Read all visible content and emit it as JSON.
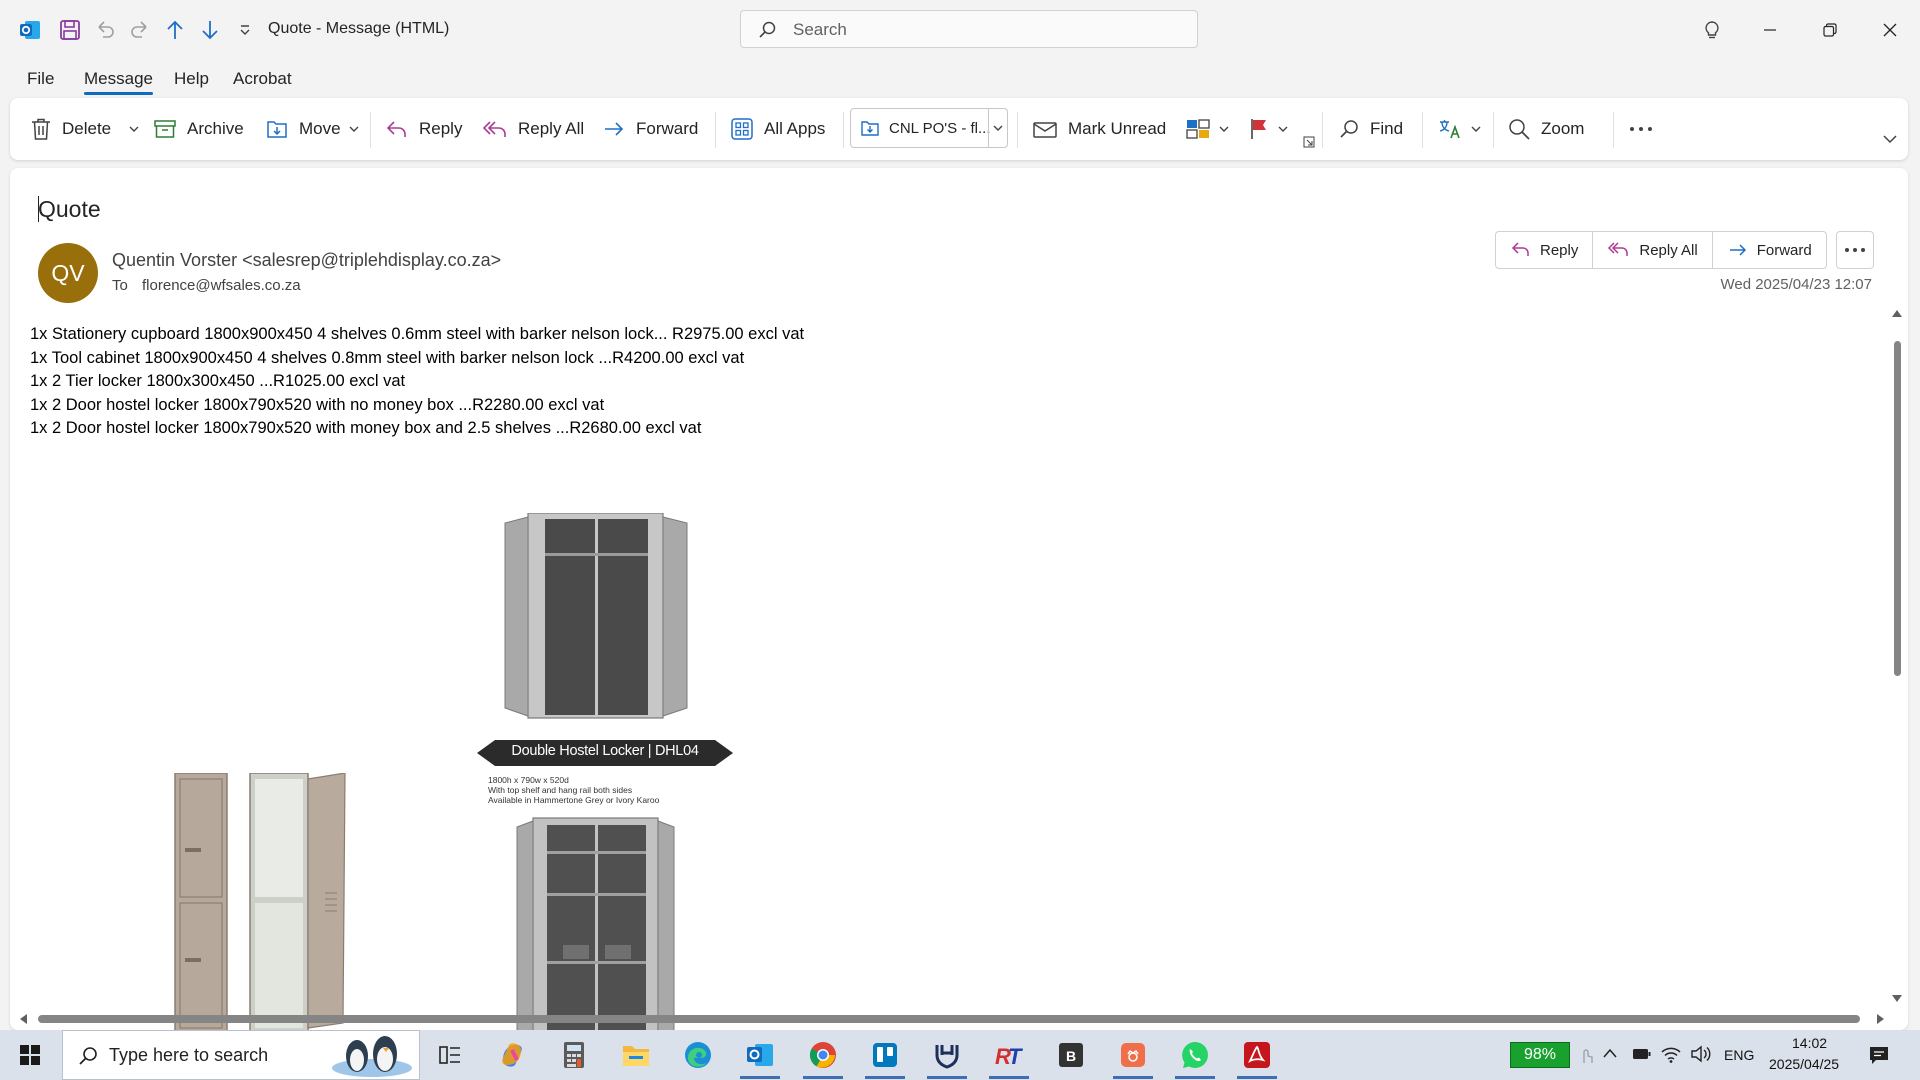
{
  "window": {
    "title": "Quote  -  Message (HTML)",
    "search_placeholder": "Search"
  },
  "menu": {
    "file": "File",
    "message": "Message",
    "help": "Help",
    "acrobat": "Acrobat"
  },
  "ribbon": {
    "delete": "Delete",
    "archive": "Archive",
    "move": "Move",
    "reply": "Reply",
    "reply_all": "Reply All",
    "forward": "Forward",
    "all_apps": "All Apps",
    "quick_step": "CNL PO'S - fl...",
    "mark_unread": "Mark Unread",
    "find": "Find",
    "zoom": "Zoom"
  },
  "email": {
    "subject": "Quote",
    "avatar_initials": "QV",
    "avatar_color": "#986f0b",
    "sender": "Quentin Vorster <salesrep@triplehdisplay.co.za>",
    "to_label": "To",
    "to": "florence@wfsales.co.za",
    "date": "Wed 2025/04/23 12:07",
    "actions": {
      "reply": "Reply",
      "reply_all": "Reply All",
      "forward": "Forward"
    },
    "body": [
      "1x Stationery cupboard 1800x900x450 4 shelves  0.6mm steel with barker nelson lock... R2975.00 excl vat",
      "1x Tool cabinet 1800x900x450 4 shelves  0.8mm steel with barker nelson lock ...R4200.00 excl vat",
      "1x 2 Tier locker 1800x300x450 ...R1025.00 excl vat",
      "1x 2 Door hostel locker 1800x790x520 with no money box ...R2280.00 excl vat",
      "1x 2 Door hostel locker 1800x790x520 with money box and 2.5 shelves ...R2680.00 excl vat"
    ],
    "image": {
      "banner": "Double Hostel Locker | DHL04",
      "spec_lines": [
        "1800h x 790w x 520d",
        "With top shelf and hang rail both sides",
        "Available in Hammertone Grey or Ivory Karoo"
      ]
    }
  },
  "taskbar": {
    "search_placeholder": "Type here to search",
    "battery": "98%",
    "language": "ENG",
    "time": "14:02",
    "date": "2025/04/25"
  },
  "colors": {
    "accent": "#0f6cbd",
    "reply_icon": "#b03a93",
    "flag": "#d13438"
  }
}
